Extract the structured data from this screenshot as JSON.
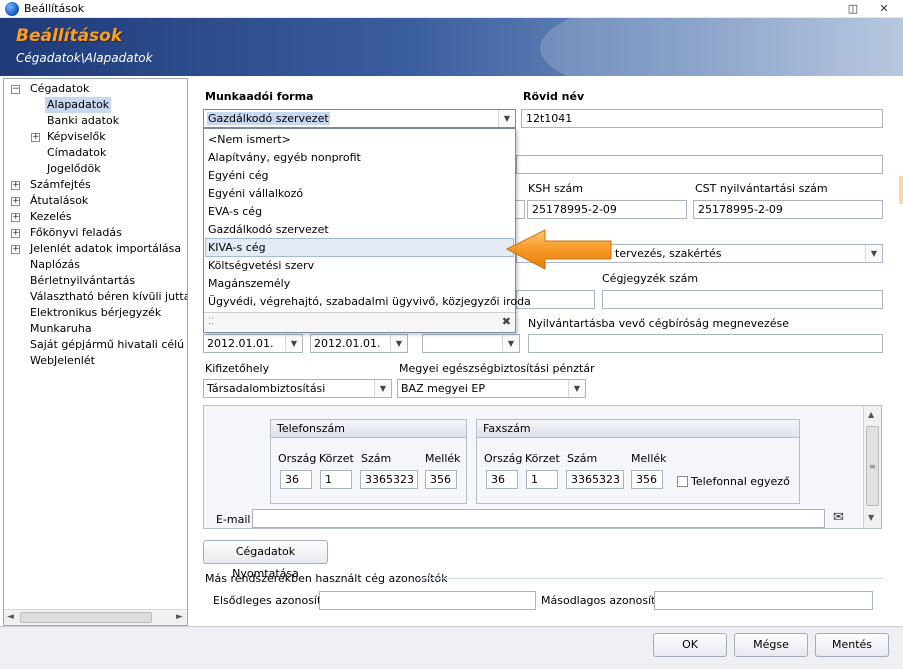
{
  "window": {
    "title": "Beállítások",
    "restore_symbol": "◫",
    "close_symbol": "✕"
  },
  "banner": {
    "title": "Beállítások",
    "breadcrumb": "Cégadatok\\Alapadatok"
  },
  "tree": {
    "items": [
      {
        "label": "Cégadatok",
        "expander": "−"
      },
      {
        "label": "Alapadatok",
        "selected": true
      },
      {
        "label": "Banki adatok"
      },
      {
        "label": "Képviselők",
        "expander": "+"
      },
      {
        "label": "Címadatok"
      },
      {
        "label": "Jogelődök"
      },
      {
        "label": "Számfejtés",
        "expander": "+"
      },
      {
        "label": "Átutalások",
        "expander": "+"
      },
      {
        "label": "Kezelés",
        "expander": "+"
      },
      {
        "label": "Főkönyvi feladás",
        "expander": "+"
      },
      {
        "label": "Jelenlét adatok importálása",
        "expander": "+"
      },
      {
        "label": "Naplózás"
      },
      {
        "label": "Bérletnyilvántartás"
      },
      {
        "label": "Választható béren kívüli juttatás"
      },
      {
        "label": "Elektronikus bérjegyzék"
      },
      {
        "label": "Munkaruha"
      },
      {
        "label": "Saját gépjármű hivatali célú hasz"
      },
      {
        "label": "WebJelenlét"
      }
    ],
    "scroll_left": "◄",
    "scroll_right": "►"
  },
  "form": {
    "munkaadoi_forma_label": "Munkaadói forma",
    "munkaadoi_forma_value": "Gazdálkodó szervezet",
    "rovid_nev_label": "Rövid név",
    "rovid_nev_value": "12t1041",
    "ksh_label": "KSH szám",
    "ksh_value": "25178995-2-09",
    "cst_label": "CST nyilvántartási szám",
    "cst_value": "25178995-2-09",
    "tevekenyseg_partial": "tervezés, szakértés",
    "cegjegyzek_label": "Cégjegyzék szám",
    "cegjegyzek_value": "",
    "date1": "2012.01.01.",
    "date2": "2012.01.01.",
    "cegbirosag_label": "Nyilvántartásba vevő cégbíróság megnevezése",
    "cegbirosag_value": "",
    "kifizetohely_label": "Kifizetőhely",
    "kifizetohely_value": "Társadalombiztosítási",
    "penztar_label": "Megyei egészségbiztosítási pénztár",
    "penztar_value": "BAZ megyei EP"
  },
  "dropdown": {
    "options": [
      "<Nem ismert>",
      "Alapítvány, egyéb nonprofit",
      "Egyéni cég",
      "Egyéni vállalkozó",
      "EVA-s cég",
      "Gazdálkodó szervezet",
      "KIVA-s cég",
      "Költségvetési szerv",
      "Magánszemély",
      "Ügyvédi, végrehajtó, szabadalmi ügyvivő, közjegyzői iroda"
    ],
    "grip": "⁚⁚",
    "close": "✖"
  },
  "contact": {
    "telefon": {
      "title": "Telefonszám",
      "orszag_label": "Ország",
      "korzet_label": "Körzet",
      "szam_label": "Szám",
      "mellek_label": "Mellék",
      "orszag": "36",
      "korzet": "1",
      "szam": "3365323",
      "mellek": "356"
    },
    "fax": {
      "title": "Faxszám",
      "orszag_label": "Ország",
      "korzet_label": "Körzet",
      "szam_label": "Szám",
      "mellek_label": "Mellék",
      "orszag": "36",
      "korzet": "1",
      "szam": "3365323",
      "mellek": "356"
    },
    "same_as_phone_label": "Telefonnal egyező",
    "email_label": "E-mail",
    "email_value": "",
    "email_icon": "✉",
    "scroll_up": "▲",
    "scroll_down": "▼",
    "scroll_grip": "≡"
  },
  "print_button": "Cégadatok Nyomtatása",
  "other_ids": {
    "section_label": "Más rendszerekben használt cég azonosítók",
    "primary_label": "Elsődleges azonosító",
    "primary_value": "",
    "secondary_label": "Másodlagos azonosító",
    "secondary_value": ""
  },
  "footer": {
    "ok": "OK",
    "cancel": "Mégse",
    "save": "Mentés"
  },
  "combo_arrow": "▼",
  "colors": {
    "banner_title": "#ff9c1a",
    "selection": "#c7d7ef",
    "pointer_arrow": "#f7941d"
  }
}
